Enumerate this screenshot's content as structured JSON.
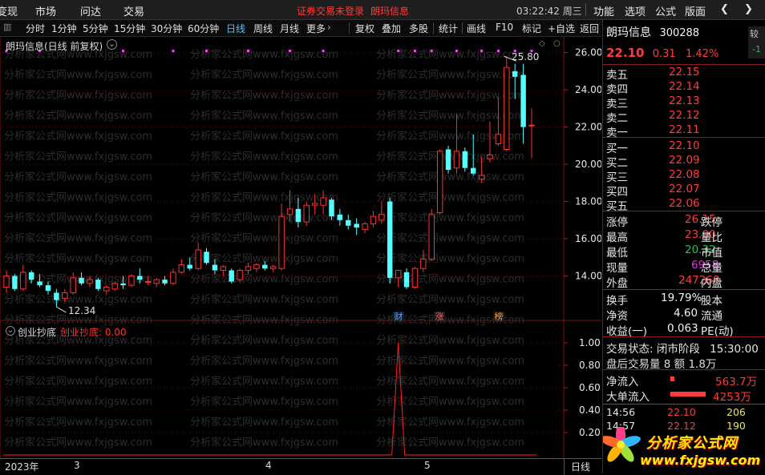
{
  "menu": {
    "items": [
      "变现",
      "市场",
      "问达",
      "交易"
    ],
    "notice": "证券交易未登录",
    "stock_name": "朗玛信息",
    "clock": "03:22:42 周三",
    "right_items": [
      "功能",
      "选项",
      "公式",
      "版面"
    ]
  },
  "toolbar": {
    "periods": [
      "分时",
      "1分钟",
      "5分钟",
      "15分钟",
      "30分钟",
      "60分钟",
      "日线",
      "周线",
      "月线",
      "更多"
    ],
    "active_period": "日线",
    "tools": [
      "复权",
      "叠加",
      "多股",
      "统计",
      "画线",
      "F10",
      "标记",
      "+自选",
      "返回"
    ]
  },
  "main_chart": {
    "title": "朗玛信息(日线 前复权)",
    "high_label": "25.80",
    "low_label": "12.34",
    "watermark_text": "分析家公式网www.fxjgsw.com",
    "event_tags": [
      {
        "text": "财",
        "color": "#5aa0ff"
      },
      {
        "text": "涨",
        "color": "#ff6060"
      },
      {
        "text": "榜",
        "color": "#ff9a2a"
      }
    ]
  },
  "sub_chart": {
    "indicator_name": "创业抄底",
    "indicator_value_label": "创业抄底: 0.00"
  },
  "chart_data": [
    {
      "type": "candlestick",
      "title": "朗玛信息(日线 前复权)",
      "ylim": [
        12.0,
        26.5
      ],
      "yticks": [
        14.0,
        16.0,
        18.0,
        20.0,
        22.0,
        24.0,
        26.0
      ],
      "ytick_labels": [
        "14.00",
        "16.00",
        "18.00",
        "20.00",
        "22.00",
        "24.00",
        "26.00"
      ],
      "x_labels": [
        {
          "text": "2023年",
          "index": 0
        },
        {
          "text": "3",
          "index": 7
        },
        {
          "text": "4",
          "index": 27
        },
        {
          "text": "5",
          "index": 43
        }
      ],
      "bars": [
        {
          "o": 13.4,
          "h": 14.3,
          "l": 13.1,
          "c": 14.0
        },
        {
          "o": 14.0,
          "h": 14.1,
          "l": 13.2,
          "c": 13.3
        },
        {
          "o": 13.3,
          "h": 14.6,
          "l": 13.2,
          "c": 14.2
        },
        {
          "o": 14.2,
          "h": 14.3,
          "l": 13.6,
          "c": 13.8
        },
        {
          "o": 13.7,
          "h": 14.1,
          "l": 13.4,
          "c": 13.5
        },
        {
          "o": 13.5,
          "h": 13.7,
          "l": 13.0,
          "c": 13.2
        },
        {
          "o": 13.1,
          "h": 13.3,
          "l": 12.34,
          "c": 12.7
        },
        {
          "o": 12.8,
          "h": 13.3,
          "l": 12.6,
          "c": 13.1
        },
        {
          "o": 13.1,
          "h": 14.2,
          "l": 13.0,
          "c": 13.9
        },
        {
          "o": 13.9,
          "h": 14.2,
          "l": 13.5,
          "c": 13.6
        },
        {
          "o": 13.6,
          "h": 14.0,
          "l": 13.4,
          "c": 13.8
        },
        {
          "o": 13.8,
          "h": 13.9,
          "l": 13.2,
          "c": 13.3
        },
        {
          "o": 13.2,
          "h": 13.5,
          "l": 13.0,
          "c": 13.4
        },
        {
          "o": 13.3,
          "h": 13.7,
          "l": 13.2,
          "c": 13.6
        },
        {
          "o": 13.6,
          "h": 14.0,
          "l": 13.3,
          "c": 13.5
        },
        {
          "o": 13.5,
          "h": 14.1,
          "l": 13.4,
          "c": 14.0
        },
        {
          "o": 14.0,
          "h": 14.4,
          "l": 13.6,
          "c": 13.8
        },
        {
          "o": 13.7,
          "h": 14.0,
          "l": 13.5,
          "c": 13.7
        },
        {
          "o": 13.6,
          "h": 13.9,
          "l": 13.4,
          "c": 13.8
        },
        {
          "o": 13.8,
          "h": 14.0,
          "l": 13.5,
          "c": 13.6
        },
        {
          "o": 13.6,
          "h": 14.4,
          "l": 13.5,
          "c": 14.2
        },
        {
          "o": 14.2,
          "h": 14.9,
          "l": 14.1,
          "c": 14.6
        },
        {
          "o": 14.6,
          "h": 15.0,
          "l": 14.3,
          "c": 14.4
        },
        {
          "o": 14.4,
          "h": 15.8,
          "l": 14.3,
          "c": 15.4
        },
        {
          "o": 15.3,
          "h": 15.5,
          "l": 14.6,
          "c": 14.7
        },
        {
          "o": 14.6,
          "h": 14.9,
          "l": 14.1,
          "c": 14.3
        },
        {
          "o": 14.3,
          "h": 14.6,
          "l": 14.0,
          "c": 14.5
        },
        {
          "o": 14.3,
          "h": 14.4,
          "l": 13.6,
          "c": 13.7
        },
        {
          "o": 13.8,
          "h": 14.4,
          "l": 13.7,
          "c": 14.3
        },
        {
          "o": 14.3,
          "h": 14.7,
          "l": 14.1,
          "c": 14.5
        },
        {
          "o": 14.4,
          "h": 14.7,
          "l": 14.2,
          "c": 14.6
        },
        {
          "o": 14.6,
          "h": 14.8,
          "l": 14.3,
          "c": 14.4
        },
        {
          "o": 14.4,
          "h": 14.6,
          "l": 14.2,
          "c": 14.5
        },
        {
          "o": 14.4,
          "h": 17.9,
          "l": 14.3,
          "c": 17.2
        },
        {
          "o": 17.3,
          "h": 18.6,
          "l": 16.9,
          "c": 17.6
        },
        {
          "o": 17.6,
          "h": 18.2,
          "l": 16.6,
          "c": 16.9
        },
        {
          "o": 16.9,
          "h": 18.0,
          "l": 16.7,
          "c": 17.8
        },
        {
          "o": 17.8,
          "h": 18.4,
          "l": 17.3,
          "c": 17.9
        },
        {
          "o": 17.8,
          "h": 18.6,
          "l": 17.3,
          "c": 18.2
        },
        {
          "o": 18.1,
          "h": 18.2,
          "l": 17.0,
          "c": 17.2
        },
        {
          "o": 17.3,
          "h": 17.6,
          "l": 16.7,
          "c": 17.0
        },
        {
          "o": 17.0,
          "h": 17.3,
          "l": 16.5,
          "c": 16.7
        },
        {
          "o": 16.8,
          "h": 17.1,
          "l": 16.2,
          "c": 16.6
        },
        {
          "o": 16.5,
          "h": 16.9,
          "l": 16.3,
          "c": 16.8
        },
        {
          "o": 16.8,
          "h": 17.5,
          "l": 16.6,
          "c": 17.2
        },
        {
          "o": 17.0,
          "h": 18.0,
          "l": 16.8,
          "c": 17.3
        },
        {
          "o": 18.0,
          "h": 18.2,
          "l": 13.6,
          "c": 13.9
        },
        {
          "o": 13.9,
          "h": 14.2,
          "l": 13.4,
          "c": 14.3
        },
        {
          "o": 14.2,
          "h": 14.4,
          "l": 13.3,
          "c": 13.4
        },
        {
          "o": 13.4,
          "h": 14.5,
          "l": 13.3,
          "c": 14.4
        },
        {
          "o": 14.4,
          "h": 15.4,
          "l": 14.2,
          "c": 14.9
        },
        {
          "o": 14.9,
          "h": 17.6,
          "l": 14.8,
          "c": 17.3
        },
        {
          "o": 17.4,
          "h": 20.8,
          "l": 17.3,
          "c": 20.7
        },
        {
          "o": 20.8,
          "h": 21.0,
          "l": 19.5,
          "c": 19.7
        },
        {
          "o": 19.8,
          "h": 22.7,
          "l": 19.5,
          "c": 20.7
        },
        {
          "o": 20.7,
          "h": 20.9,
          "l": 19.6,
          "c": 19.8
        },
        {
          "o": 19.8,
          "h": 21.6,
          "l": 19.4,
          "c": 19.5
        },
        {
          "o": 19.2,
          "h": 20.4,
          "l": 19.0,
          "c": 19.4
        },
        {
          "o": 20.3,
          "h": 22.3,
          "l": 20.1,
          "c": 20.5
        },
        {
          "o": 21.1,
          "h": 23.6,
          "l": 21.0,
          "c": 21.6
        },
        {
          "o": 20.8,
          "h": 25.8,
          "l": 20.7,
          "c": 25.2
        },
        {
          "o": 25.0,
          "h": 25.4,
          "l": 23.5,
          "c": 24.7
        },
        {
          "o": 24.8,
          "h": 25.4,
          "l": 21.1,
          "c": 22.0
        },
        {
          "o": 22.1,
          "h": 23.0,
          "l": 20.32,
          "c": 22.1
        }
      ],
      "signal_dots_at": [
        0,
        4,
        14,
        20,
        24,
        29,
        34,
        38,
        47,
        49,
        51,
        54,
        57,
        59,
        61,
        63
      ]
    },
    {
      "type": "line",
      "title": "创业抄底",
      "ylim": [
        0.0,
        1.05
      ],
      "yticks": [
        0.2,
        0.4,
        0.6,
        0.8,
        1.0
      ],
      "ytick_labels": [
        "0.20",
        "0.40",
        "0.60",
        "0.80",
        "1.00"
      ],
      "series": [
        {
          "name": "创业抄底",
          "spike_index": 47,
          "spike_value": 1.0,
          "baseline": 0.0
        }
      ]
    }
  ],
  "right_panel": {
    "stock_name": "朗玛信息",
    "stock_code": "300288",
    "price": "22.10",
    "change": "0.31",
    "change_pct": "1.42%",
    "partial_right_label": "较",
    "asks": [
      {
        "label": "卖五",
        "price": "22.15"
      },
      {
        "label": "卖四",
        "price": "22.14"
      },
      {
        "label": "卖三",
        "price": "22.13"
      },
      {
        "label": "卖二",
        "price": "22.12"
      },
      {
        "label": "卖一",
        "price": "22.11"
      }
    ],
    "bids": [
      {
        "label": "买一",
        "price": "22.10"
      },
      {
        "label": "买二",
        "price": "22.09"
      },
      {
        "label": "买三",
        "price": "22.08"
      },
      {
        "label": "买四",
        "price": "22.07"
      },
      {
        "label": "买五",
        "price": "22.06"
      }
    ],
    "stats": [
      {
        "label": "涨停",
        "value": "26.15",
        "label2": "跌停",
        "value_color": "#ff3b3b"
      },
      {
        "label": "最高",
        "value": "23.00",
        "label2": "量比",
        "value_color": "#ff3b3b"
      },
      {
        "label": "最低",
        "value": "20.32",
        "label2": "市值",
        "value_color": "#21c24e"
      },
      {
        "label": "现量",
        "value": "6958",
        "label2": "总量",
        "value_color": "#e030e0"
      },
      {
        "label": "外盘",
        "value": "247268",
        "label2": "内盘",
        "value_color": "#ff3b3b"
      }
    ],
    "stats2": [
      {
        "label": "换手",
        "value": "19.79%",
        "label2": "股本"
      },
      {
        "label": "净资",
        "value": "4.60",
        "label2": "流通"
      },
      {
        "label": "收益(一)",
        "value": "0.063",
        "label2": "PE(动)"
      }
    ],
    "trade_status_label": "交易状态:",
    "trade_status_value": "闭市阶段",
    "trade_status_time": "15:30:00",
    "after_hours": "盘后交易量 8 额 1.8万",
    "net_inflow_label": "净流入",
    "net_inflow_value": "563.7万",
    "big_order_label": "大单流入",
    "big_order_value": "4253万",
    "ticks": [
      {
        "time": "14:56",
        "price": "22.10",
        "vol": "206"
      },
      {
        "time": "14:57",
        "price": "22.12",
        "vol": "190"
      }
    ],
    "logo_text": "分析家公式网",
    "logo_url": "www.fxjgsw.com"
  },
  "bottombar": {
    "period_label": "日线"
  }
}
